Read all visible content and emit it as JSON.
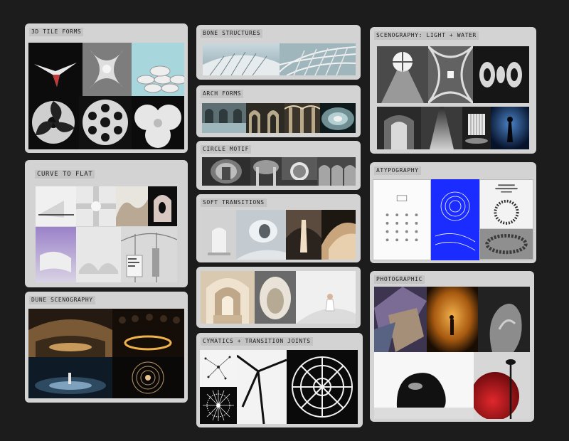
{
  "board": {
    "cards": {
      "tile": {
        "title": "3D TILE FORMS"
      },
      "bone": {
        "title": "BONE STRUCTURES"
      },
      "sceno": {
        "title": "SCENOGRAPHY: LIGHT + WATER"
      },
      "arch": {
        "title": "ARCH FORMS"
      },
      "circle": {
        "title": "CIRCLE MOTIF"
      },
      "curve": {
        "title": "CURVE TO FLAT"
      },
      "typo": {
        "title": "ATYPOGRAPHY"
      },
      "soft": {
        "title": "SOFT TRANSITIONS"
      },
      "untitled": {
        "title": ""
      },
      "photo": {
        "title": "PHOTOGRAPHIC"
      },
      "dune": {
        "title": "DUNE SCENOGRAPHY"
      },
      "cym": {
        "title": "CYMATICS + TRANSITION JOINTS"
      }
    }
  },
  "colors": {
    "canvas": "#1c1c1c",
    "card": "#d3d3d3",
    "title_tab": "#c4c4c4",
    "accent_blue": "#1a2cff",
    "accent_red": "#c0141a",
    "accent_amber": "#d58a28"
  }
}
